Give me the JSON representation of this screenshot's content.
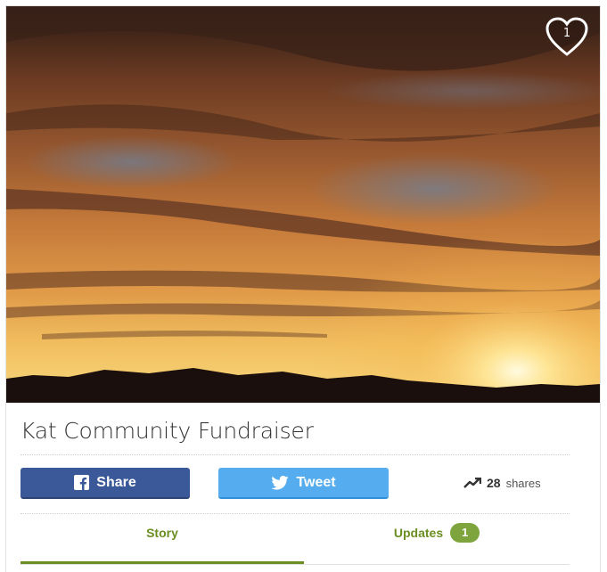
{
  "hero": {
    "favorites_count": "1"
  },
  "campaign": {
    "title": "Kat Community Fundraiser"
  },
  "share": {
    "facebook_label": "Share",
    "twitter_label": "Tweet",
    "shares_count": "28",
    "shares_label": "shares"
  },
  "tabs": [
    {
      "label": "Story",
      "active": true
    },
    {
      "label": "Updates",
      "badge": "1",
      "active": false
    }
  ],
  "colors": {
    "facebook": "#3b5998",
    "twitter": "#55acee",
    "accent": "#6b8e23",
    "badge": "#7ea53d"
  },
  "icons": [
    "heart-icon",
    "facebook-icon",
    "twitter-icon",
    "trending-up-icon"
  ]
}
